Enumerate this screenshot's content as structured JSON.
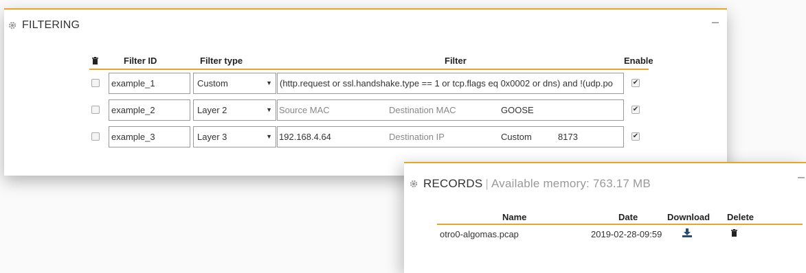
{
  "filtering": {
    "title": "FILTERING",
    "columns": {
      "id": "Filter ID",
      "type": "Filter type",
      "filter": "Filter",
      "enable": "Enable"
    },
    "rows": [
      {
        "id": "example_1",
        "type": "Custom",
        "filter_text": "(http.request or ssl.handshake.type == 1 or tcp.flags eq 0x0002 or dns) and !(udp.po",
        "enabled": true
      },
      {
        "id": "example_2",
        "type": "Layer 2",
        "source": "Source MAC",
        "destination": "Destination MAC",
        "protocol": "GOOSE",
        "enabled": true
      },
      {
        "id": "example_3",
        "type": "Layer 3",
        "source": "192.168.4.64",
        "destination": "Destination IP",
        "protocol": "Custom",
        "port": "8173",
        "enabled": true
      }
    ]
  },
  "records": {
    "title": "RECORDS",
    "subtitle": "Available memory: 763.17 MB",
    "columns": {
      "name": "Name",
      "date": "Date",
      "download": "Download",
      "delete": "Delete"
    },
    "rows": [
      {
        "name": "otro0-algomas.pcap",
        "date": "2019-02-28-09:59"
      }
    ]
  },
  "icons": {
    "panel": "gear-icon",
    "delete_all": "trash-icon",
    "download": "download-icon",
    "delete": "trash-icon"
  },
  "colors": {
    "accent": "#e8a427",
    "border": "#999999"
  }
}
